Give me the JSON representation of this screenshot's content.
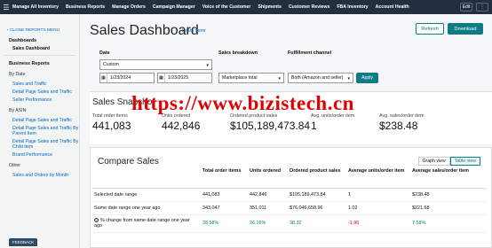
{
  "topnav": {
    "items": [
      "Manage All Inventory",
      "Business Reports",
      "Manage Orders",
      "Campaign Manager",
      "Voice of the Customer",
      "Shipments",
      "Customer Reviews",
      "FBA Inventory",
      "Account Health"
    ],
    "edit_label": "Edit"
  },
  "sidebar": {
    "close_label": "CLOSE REPORTS MENU",
    "dashboards_title": "Dashboards",
    "sales_dashboard": "Sales Dashboard",
    "business_reports_title": "Business Reports",
    "by_date": "By Date",
    "sales_and_traffic": "Sales and Traffic",
    "detail_page_sales_traffic": "Detail Page Sales and Traffic",
    "seller_performance": "Seller Performance",
    "by_asin": "By ASIN",
    "detail_page_by_asin": "Detail Page Sales and Traffic",
    "detail_page_by_parent": "Detail Page Sales and Traffic By Parent Item",
    "detail_page_by_child": "Detail Page Sales and Traffic By Child Item",
    "brand_performance": "Brand Performance",
    "other": "Other",
    "sales_orders_by_month": "Sales and Orders by Month",
    "feedback": "FEEDBACK"
  },
  "header": {
    "title": "Sales Dashboard",
    "learn_more": "Learn more",
    "refresh": "Refresh",
    "download": "Download"
  },
  "filters": {
    "date_label": "Date",
    "date_value": "Custom",
    "start_date": "1/23/2024",
    "end_date": "1/23/2025",
    "breakdown_label": "Sales breakdown",
    "breakdown_value": "Marketplace total",
    "channel_label": "Fulfillment channel",
    "channel_value": "Both (Amazon and seller)",
    "apply": "Apply"
  },
  "snapshot": {
    "title": "Sales Snapshot",
    "metrics": [
      {
        "label": "Total order items",
        "value": "441,083"
      },
      {
        "label": "Units ordered",
        "value": "442,846"
      },
      {
        "label": "Ordered product sales",
        "value": "$105,189,473.84"
      },
      {
        "label": "Avg. units/order item",
        "value": "1"
      },
      {
        "label": "Avg. sales/order item",
        "value": "$238.48"
      }
    ]
  },
  "watermark": "https://www.bizistech.cn",
  "compare": {
    "title": "Compare Sales",
    "graph_view": "Graph view",
    "table_view": "Table view",
    "columns": [
      "",
      "Total order items",
      "Units ordered",
      "Ordered product sales",
      "Average units/order item",
      "Average sales/order item"
    ],
    "rows": [
      {
        "label": "Selected date range",
        "values": [
          "441,083",
          "442,846",
          "$105,189,473.84",
          "1",
          "$238.48"
        ]
      },
      {
        "label": "Same date range one year ago",
        "values": [
          "343,047",
          "351,011",
          "$76,046,658.96",
          "1.02",
          "$221.68"
        ]
      },
      {
        "label": "% change from same date range one year ago",
        "values": [
          "28.58%",
          "26.16%",
          "38.32",
          "-1.96",
          "7.58%"
        ]
      }
    ]
  }
}
